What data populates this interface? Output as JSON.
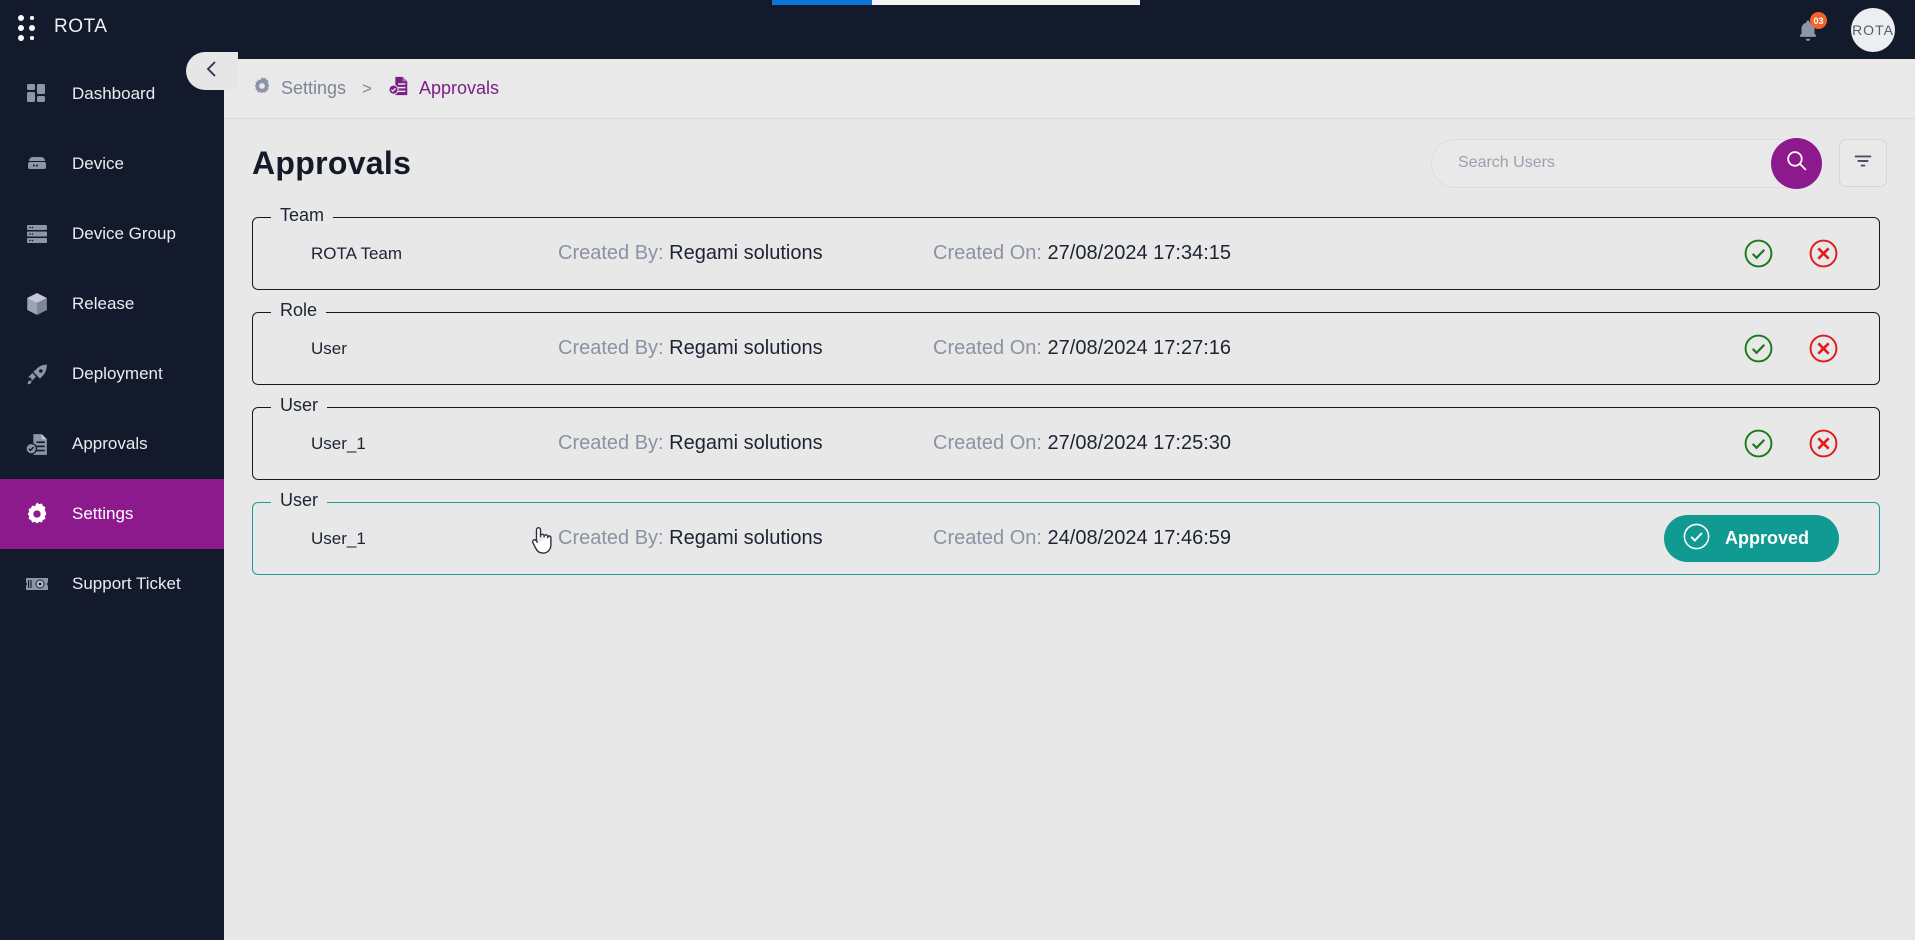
{
  "app": {
    "brand": "ROTA",
    "logo_icon": "dot-grid-icon",
    "notification_count": "03",
    "bell_icon": "bell-icon",
    "avatar_text": "ROTA",
    "accent_purple": "#8d1a8d",
    "accent_teal": "#119a92",
    "sidebar_bg": "#121a2c",
    "page_bg": "#e8e8e8",
    "badge_orange": "#f4622c"
  },
  "sidebar": {
    "collapse_icon": "chevron-left-icon",
    "items": [
      {
        "label": "Dashboard",
        "icon": "dashboard-icon",
        "active": false
      },
      {
        "label": "Device",
        "icon": "device-icon",
        "active": false
      },
      {
        "label": "Device Group",
        "icon": "device-group-icon",
        "active": false
      },
      {
        "label": "Release",
        "icon": "release-box-icon",
        "active": false
      },
      {
        "label": "Deployment",
        "icon": "rocket-icon",
        "active": false
      },
      {
        "label": "Approvals",
        "icon": "approvals-doc-icon",
        "active": false
      },
      {
        "label": "Settings",
        "icon": "gear-icon",
        "active": true
      },
      {
        "label": "Support Ticket",
        "icon": "ticket-icon",
        "active": false
      }
    ]
  },
  "breadcrumb": {
    "parent": "Settings",
    "parent_icon": "gear-icon",
    "separator": ">",
    "current": "Approvals",
    "current_icon": "approvals-doc-icon"
  },
  "page": {
    "title": "Approvals"
  },
  "search": {
    "value": "",
    "placeholder": "Search Users",
    "button_icon": "search-icon"
  },
  "filter": {
    "icon": "filter-icon"
  },
  "table": {
    "labels": {
      "created_by": "Created By:",
      "created_on": "Created On:"
    },
    "rows": [
      {
        "legend": "Team",
        "name": "ROTA Team",
        "created_by": "Regami solutions",
        "created_on": "27/08/2024 17:34:15",
        "state": "pending",
        "approve_icon": "check-circle-icon",
        "reject_icon": "close-circle-icon"
      },
      {
        "legend": "Role",
        "name": "User",
        "created_by": "Regami solutions",
        "created_on": "27/08/2024 17:27:16",
        "state": "pending",
        "approve_icon": "check-circle-icon",
        "reject_icon": "close-circle-icon"
      },
      {
        "legend": "User",
        "name": "User_1",
        "created_by": "Regami solutions",
        "created_on": "27/08/2024 17:25:30",
        "state": "pending",
        "approve_icon": "check-circle-icon",
        "reject_icon": "close-circle-icon"
      },
      {
        "legend": "User",
        "name": "User_1",
        "created_by": "Regami solutions",
        "created_on": "24/08/2024 17:46:59",
        "state": "approved",
        "approved_label": "Approved",
        "approved_icon": "check-circle-icon"
      }
    ]
  },
  "cursor": {
    "icon": "pointer-hand-cursor"
  }
}
